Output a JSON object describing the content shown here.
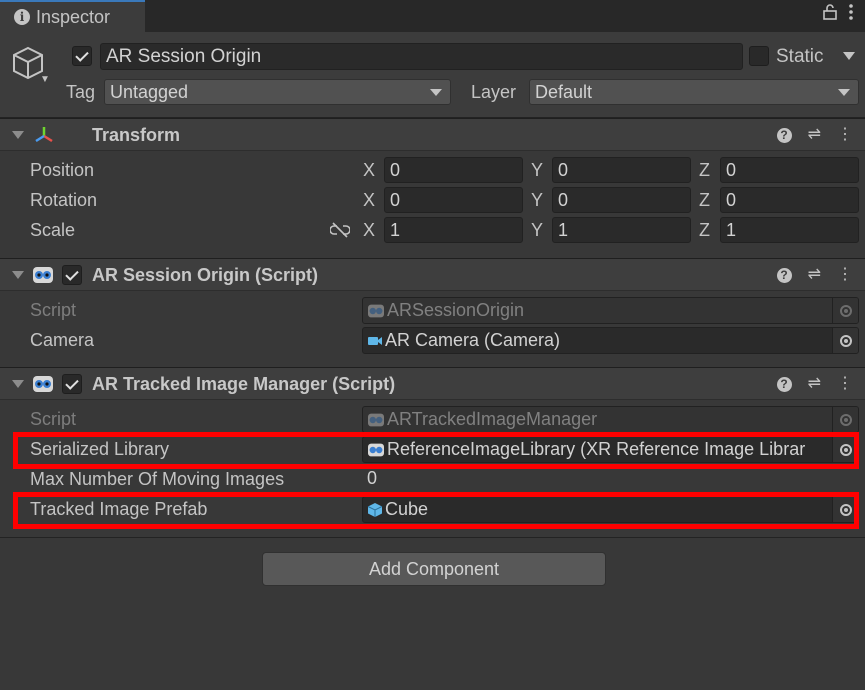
{
  "tab": {
    "title": "Inspector"
  },
  "gameobject": {
    "name": "AR Session Origin",
    "active": true,
    "static_label": "Static",
    "tag_label": "Tag",
    "tag_value": "Untagged",
    "layer_label": "Layer",
    "layer_value": "Default"
  },
  "transform": {
    "title": "Transform",
    "position": {
      "label": "Position",
      "x": "0",
      "y": "0",
      "z": "0"
    },
    "rotation": {
      "label": "Rotation",
      "x": "0",
      "y": "0",
      "z": "0"
    },
    "scale": {
      "label": "Scale",
      "x": "1",
      "y": "1",
      "z": "1"
    },
    "axis": {
      "x": "X",
      "y": "Y",
      "z": "Z"
    }
  },
  "session_origin": {
    "title": "AR Session Origin (Script)",
    "script_label": "Script",
    "script_value": "ARSessionOrigin",
    "camera_label": "Camera",
    "camera_value": "AR Camera (Camera)"
  },
  "image_manager": {
    "title": "AR Tracked Image Manager (Script)",
    "script_label": "Script",
    "script_value": "ARTrackedImageManager",
    "library_label": "Serialized Library",
    "library_value": "ReferenceImageLibrary (XR Reference Image Librar",
    "max_label": "Max Number Of Moving Images",
    "max_value": "0",
    "prefab_label": "Tracked Image Prefab",
    "prefab_value": "Cube"
  },
  "add_component": "Add Component",
  "colors": {
    "highlight": "#ff0000",
    "accent_tab": "#3a79bb"
  }
}
